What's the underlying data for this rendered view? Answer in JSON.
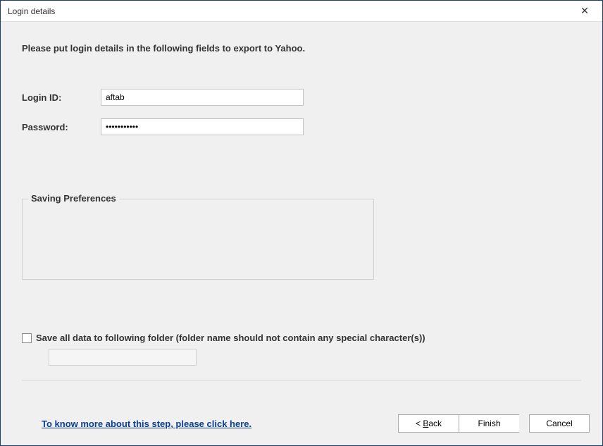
{
  "titlebar": {
    "title": "Login details"
  },
  "content": {
    "instruction": "Please put login details in the following fields to export to Yahoo.",
    "loginLabel": "Login ID:",
    "loginValue": "aftab",
    "passwordLabel": "Password:",
    "passwordValue": "•••••••••••",
    "fieldsetLabel": "Saving Preferences",
    "checkboxLabel": "Save all data to following folder (folder name should not contain any special character(s))",
    "folderValue": ""
  },
  "footer": {
    "helpLink": "To know more about this step, please click here.",
    "backPrefix": "< ",
    "backLetter": "B",
    "backSuffix": "ack",
    "finishLabel": "Finish",
    "cancelLabel": "Cancel"
  }
}
